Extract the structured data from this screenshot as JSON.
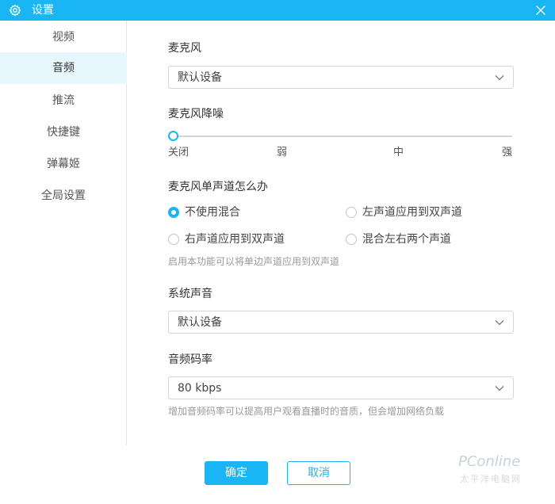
{
  "window": {
    "title": "设置"
  },
  "sidebar": {
    "items": [
      {
        "label": "视频",
        "active": false
      },
      {
        "label": "音频",
        "active": true
      },
      {
        "label": "推流",
        "active": false
      },
      {
        "label": "快捷键",
        "active": false
      },
      {
        "label": "弹幕姬",
        "active": false
      },
      {
        "label": "全局设置",
        "active": false
      }
    ]
  },
  "audio": {
    "microphone": {
      "label": "麦克风",
      "value": "默认设备"
    },
    "noise_reduction": {
      "label": "麦克风降噪",
      "level_index": 0,
      "ticks": [
        "关闭",
        "弱",
        "中",
        "强"
      ]
    },
    "mono": {
      "label": "麦克风单声道怎么办",
      "options": [
        {
          "label": "不使用混合",
          "checked": true
        },
        {
          "label": "左声道应用到双声道",
          "checked": false
        },
        {
          "label": "右声道应用到双声道",
          "checked": false
        },
        {
          "label": "混合左右两个声道",
          "checked": false
        }
      ],
      "hint": "启用本功能可以将单边声道应用到双声道"
    },
    "system_sound": {
      "label": "系统声音",
      "value": "默认设备"
    },
    "bitrate": {
      "label": "音频码率",
      "value": "80 kbps",
      "hint": "增加音频码率可以提高用户观看直播时的音质，但会增加网络负载"
    }
  },
  "footer": {
    "confirm_label": "确定",
    "cancel_label": "取消"
  },
  "watermark": {
    "brand": "PConline",
    "sub": "太平洋电脑网"
  },
  "colors": {
    "accent": "#19b5f4",
    "active_bg": "#e8f6fd"
  }
}
